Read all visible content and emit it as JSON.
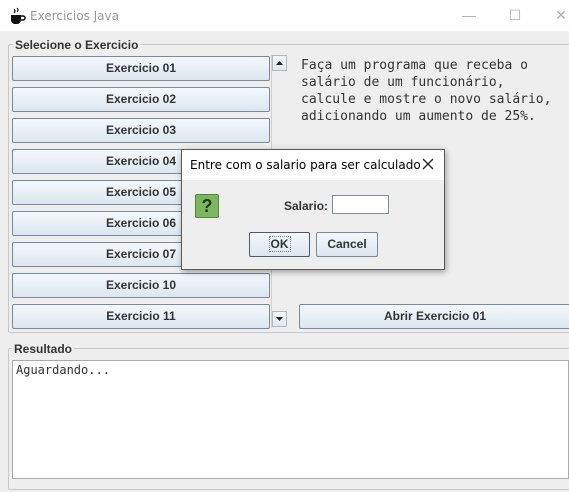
{
  "window": {
    "title": "Exercicios Java",
    "min_glyph": "—",
    "max_glyph": "☐",
    "close_glyph": "✕"
  },
  "exercise_group": {
    "title": "Selecione o Exercicio",
    "buttons": [
      "Exercicio 01",
      "Exercicio 02",
      "Exercicio 03",
      "Exercicio 04",
      "Exercicio 05",
      "Exercicio 06",
      "Exercicio 07",
      "Exercicio 10",
      "Exercicio 11"
    ]
  },
  "description": "Faça um programa que receba o\nsalário de um funcionário,\ncalcule e mostre o novo salário,\nadicionando um aumento de 25%.",
  "open_button_label": "Abrir Exercicio 01",
  "result_group": {
    "title": "Resultado",
    "text": "Aguardando..."
  },
  "dialog": {
    "title": "Entre com o salario para ser calculado",
    "icon": "question-icon",
    "icon_glyph": "?",
    "field_label": "Salario:",
    "field_value": "",
    "ok_label": "OK",
    "cancel_label": "Cancel"
  },
  "colors": {
    "accent": "#7db660",
    "button_top": "#f4f8fc",
    "button_bottom": "#dde6ef"
  }
}
